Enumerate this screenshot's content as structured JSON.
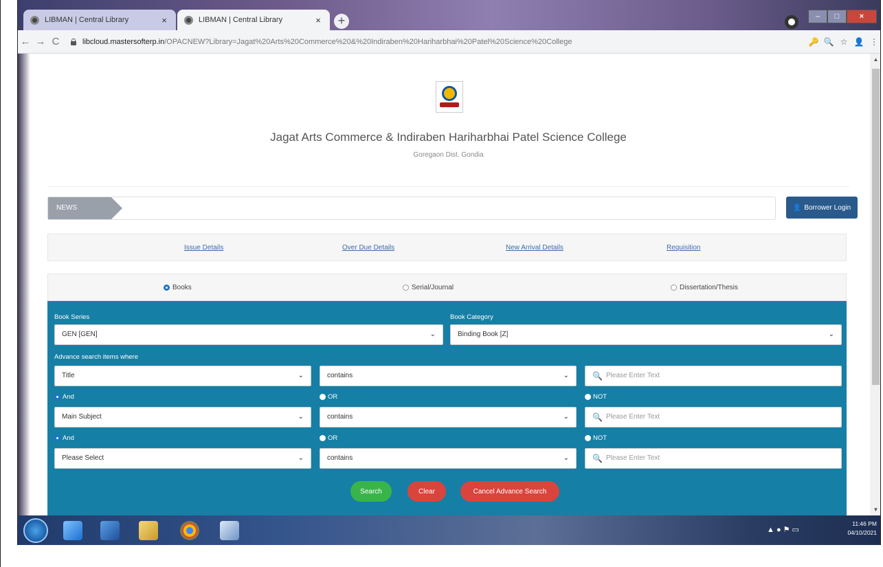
{
  "browser": {
    "tabs": [
      {
        "title": "LIBMAN | Central Library",
        "close": "×"
      },
      {
        "title": "LIBMAN | Central Library",
        "close": "×"
      }
    ],
    "new_tab": "+",
    "url_host": "libcloud.mastersofterp.in",
    "url_path": "/OPACNEW?Library=Jagat%20Arts%20Commerce%20&%20Indiraben%20Hariharbhai%20Patel%20Science%20College",
    "nav": {
      "back": "←",
      "forward": "→",
      "reload": "C"
    },
    "toolbar_icons": {
      "key": "🔑",
      "zoom": "🔍",
      "star": "☆",
      "account": "👤",
      "menu": "⋮"
    }
  },
  "header": {
    "college_name": "Jagat Arts Commerce & Indiraben Hariharbhai Patel Science College",
    "place": "Goregaon Dist. Gondia"
  },
  "news": {
    "label": "NEWS"
  },
  "borrower_login": {
    "label": "Borrower Login",
    "icon": "👤"
  },
  "links": [
    "Issue Details",
    "Over Due Details",
    "New Arrival Details",
    "Requisition"
  ],
  "material_types": [
    {
      "label": "Books",
      "selected": true
    },
    {
      "label": "Serial/Journal",
      "selected": false
    },
    {
      "label": "Dissertation/Thesis",
      "selected": false
    }
  ],
  "search": {
    "book_series_label": "Book Series",
    "book_series_value": "GEN [GEN]",
    "book_category_label": "Book Category",
    "book_category_value": "Binding Book [Z]",
    "advance_label": "Advance search items where",
    "rows": [
      {
        "field": "Title",
        "operator": "contains",
        "placeholder": "Please Enter Text"
      },
      {
        "field": "Main Subject",
        "operator": "contains",
        "placeholder": "Please Enter Text"
      },
      {
        "field": "Please Select",
        "operator": "contains",
        "placeholder": "Please Enter Text"
      }
    ],
    "logic": [
      {
        "and": "And",
        "or": "OR",
        "not": "NOT"
      },
      {
        "and": "And",
        "or": "OR",
        "not": "NOT"
      }
    ],
    "buttons": {
      "search": "Search",
      "clear": "Clear",
      "cancel": "Cancel Advance Search"
    }
  },
  "taskbar": {
    "time": "11:46 PM",
    "date": "04/10/2021"
  },
  "colors": {
    "panel": "#167fa5",
    "search_btn": "#39b44a",
    "danger_btn": "#d9443c",
    "login_btn": "#2a5a8c"
  }
}
